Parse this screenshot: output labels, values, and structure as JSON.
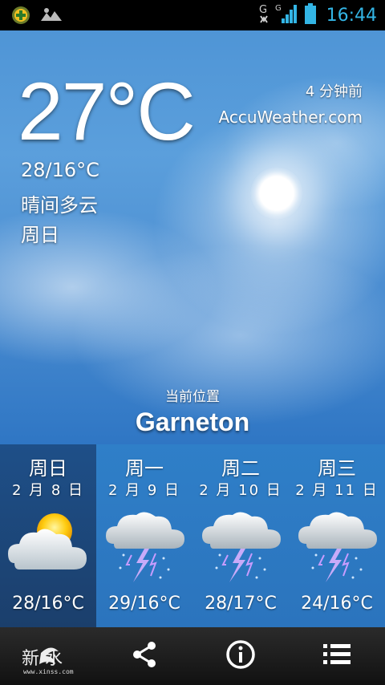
{
  "status_bar": {
    "time": "16:44",
    "network_label": "G",
    "icons": [
      "app-badge-icon",
      "image-icon",
      "network-g-icon",
      "signal-icon",
      "battery-icon"
    ]
  },
  "current": {
    "temperature": "27°C",
    "high_low": "28/16°C",
    "condition": "晴间多云",
    "day": "周日",
    "updated": "4 分钟前",
    "source": "AccuWeather.com"
  },
  "location": {
    "label": "当前位置",
    "name": "Garneton",
    "pages": 4,
    "active_page": 0
  },
  "forecast": [
    {
      "name": "周日",
      "date": "2 月 8 日",
      "temp": "28/16°C",
      "icon": "partly-cloudy-icon",
      "active": true
    },
    {
      "name": "周一",
      "date": "2 月 9 日",
      "temp": "29/16°C",
      "icon": "thunderstorm-icon",
      "active": false
    },
    {
      "name": "周二",
      "date": "2 月 10 日",
      "temp": "28/17°C",
      "icon": "thunderstorm-icon",
      "active": false
    },
    {
      "name": "周三",
      "date": "2 月 11 日",
      "temp": "24/16°C",
      "icon": "thunderstorm-icon",
      "active": false
    }
  ],
  "bottom_bar": {
    "watermark_text": "新  水",
    "watermark_url": "www.xinss.com",
    "items": [
      "watermark-logo",
      "share-icon",
      "info-icon",
      "menu-list-icon"
    ]
  },
  "colors": {
    "time_color": "#33b5e5",
    "sky_top": "#4f95d6",
    "forecast_bg": "#2f7fc8",
    "forecast_active_bg": "#1e4f88"
  }
}
